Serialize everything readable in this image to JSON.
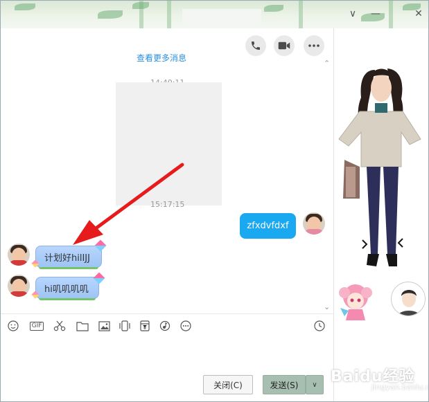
{
  "window": {
    "controls": {
      "dropdown": "∨",
      "minimize": "—",
      "close": "✕"
    }
  },
  "header": {
    "call_icon": "phone-icon",
    "video_icon": "video-icon",
    "more_icon": "more-icon"
  },
  "chat": {
    "top_link": "查看更多消息",
    "timestamp_top": "14:40:11",
    "timestamp_mid": "15:17:15",
    "messages": [
      {
        "side": "right",
        "text": "zfxdvfdxf"
      },
      {
        "side": "left",
        "text": "计划好hilIJJ"
      },
      {
        "side": "left",
        "text": "hi叽叽叽叽"
      }
    ]
  },
  "toolbar": {
    "items": [
      {
        "name": "emoji-icon"
      },
      {
        "name": "gif-icon",
        "label": "GIF"
      },
      {
        "name": "scissors-icon"
      },
      {
        "name": "folder-icon"
      },
      {
        "name": "image-icon"
      },
      {
        "name": "shake-icon"
      },
      {
        "name": "red-packet-icon"
      },
      {
        "name": "music-icon"
      },
      {
        "name": "more-icon"
      }
    ],
    "history_icon": "clock-icon"
  },
  "footer": {
    "close_label": "关闭(C)",
    "send_label": "发送(S)",
    "send_dropdown": "∨"
  },
  "watermark": {
    "text": "Baidu经验",
    "sub": "jingyan.baidu.com"
  },
  "colors": {
    "sent_bubble": "#1aa8f0",
    "received_bubble": "#a9cbf7",
    "arrow": "#e61c1c",
    "send_button": "#a7bfb0"
  }
}
